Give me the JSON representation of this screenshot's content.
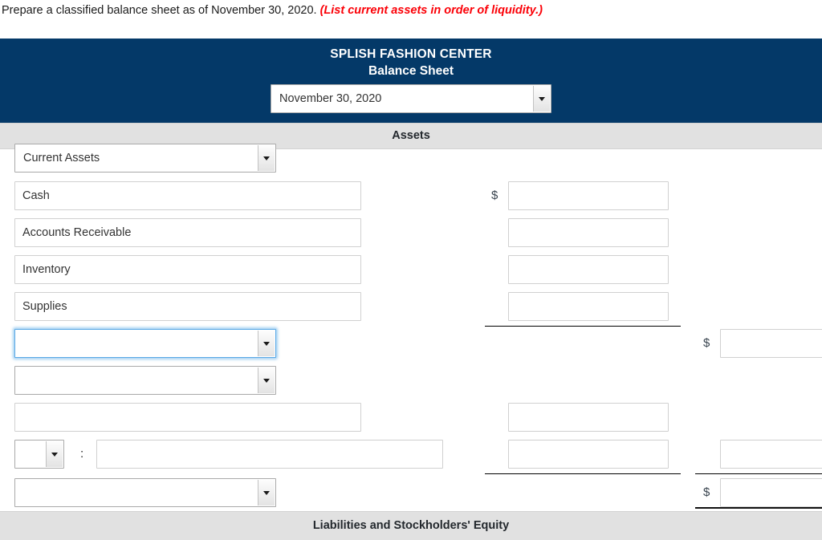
{
  "instruction": {
    "text": "Prepare a classified balance sheet as of November 30, 2020.",
    "hint": "(List current assets in order of liquidity.)"
  },
  "statement": {
    "company_name": "SPLISH FASHION CENTER",
    "statement_title": "Balance Sheet",
    "date_select": {
      "value": "November 30, 2020",
      "caret_icon": "chevron-down-icon"
    },
    "assets_heading": "Assets",
    "liabilities_heading": "Liabilities and Stockholders' Equity",
    "currency_symbol": "$",
    "colon": ":"
  },
  "rows": [
    {
      "kind": "select",
      "label": "Current Assets",
      "focused": false
    },
    {
      "kind": "text",
      "label": "Cash",
      "mid_amount": "",
      "dollar_mid": true
    },
    {
      "kind": "text",
      "label": "Accounts Receivable",
      "mid_amount": ""
    },
    {
      "kind": "text",
      "label": "Inventory",
      "mid_amount": ""
    },
    {
      "kind": "text",
      "label": "Supplies",
      "mid_amount": ""
    },
    {
      "kind": "select",
      "label": "",
      "focused": true,
      "right_amount": "",
      "dollar_right": true
    },
    {
      "kind": "select",
      "label": "",
      "focused": false
    },
    {
      "kind": "text",
      "label": "",
      "mid_amount": ""
    },
    {
      "kind": "select-colon-text",
      "label": "",
      "mid_amount": "",
      "right_amount": ""
    },
    {
      "kind": "select",
      "label": "",
      "focused": false,
      "right_amount": "",
      "dollar_right": true
    }
  ],
  "colors": {
    "navy": "#043968",
    "band_gray": "#e1e1e1",
    "hint_red": "#fb0007",
    "focus_blue": "#5aa9e6"
  }
}
